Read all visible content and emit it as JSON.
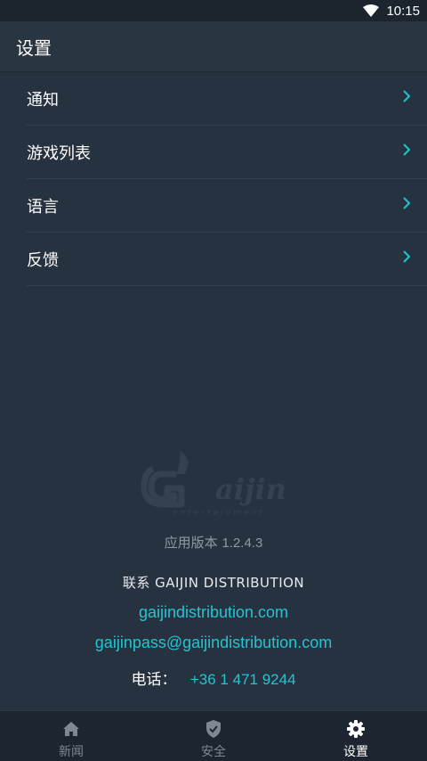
{
  "status_bar": {
    "time": "10:15",
    "icons": [
      "wifi-icon"
    ]
  },
  "app_bar": {
    "title": "设置"
  },
  "menu": {
    "items": [
      {
        "label": "通知"
      },
      {
        "label": "游戏列表"
      },
      {
        "label": "语言"
      },
      {
        "label": "反馈"
      }
    ]
  },
  "about": {
    "logo_text": "Gaijin",
    "logo_subtext": "entertainment",
    "version_label": "应用版本",
    "version_number": "1.2.4.3",
    "contact_title": "联系 GAIJIN DISTRIBUTION",
    "website": "gaijindistribution.com",
    "email": "gaijinpass@gaijindistribution.com",
    "phone_label": "电话：",
    "phone_number": "+36 1 471 9244"
  },
  "bottom_nav": {
    "tabs": [
      {
        "label": "新闻",
        "icon": "home-icon"
      },
      {
        "label": "安全",
        "icon": "shield-check-icon"
      },
      {
        "label": "设置",
        "icon": "gear-icon"
      }
    ],
    "active_index": 2
  },
  "colors": {
    "background": "#273240",
    "accent": "#25c3d0",
    "muted_text": "#8e99a5",
    "nav_background": "#1d2630"
  }
}
